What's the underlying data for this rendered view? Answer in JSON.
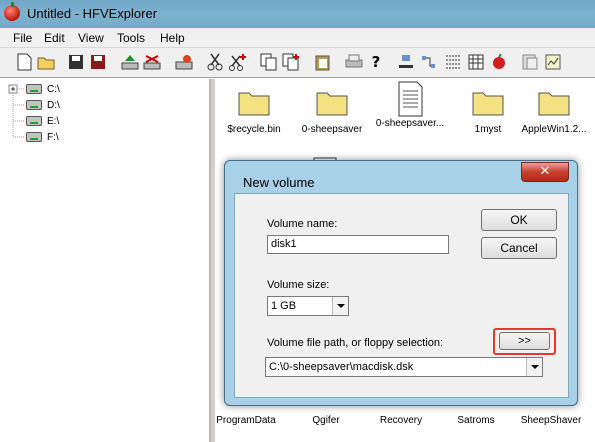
{
  "window": {
    "title": "Untitled - HFVExplorer"
  },
  "menu": [
    "File",
    "Edit",
    "View",
    "Tools",
    "Help"
  ],
  "tree": {
    "nodes": [
      "C:\\",
      "D:\\",
      "E:\\",
      "F:\\"
    ]
  },
  "files": {
    "top_row": [
      "$recycle.bin",
      "0-sheepsaver",
      "0-sheepsaver...",
      "1myst",
      "AppleWin1.2..."
    ],
    "bottom_row": [
      "ProgramData",
      "Qgifer",
      "Recovery",
      "Satroms",
      "SheepShaver"
    ]
  },
  "dialog": {
    "title": "New volume",
    "close_glyph": "✕",
    "volume_name_label": "Volume name:",
    "volume_name_value": "disk1",
    "volume_size_label": "Volume size:",
    "volume_size_value": "1 GB",
    "path_label": "Volume file path, or floppy selection:",
    "path_value": "C:\\0-sheepsaver\\macdisk.dsk",
    "ok_label": "OK",
    "cancel_label": "Cancel",
    "browse_label": ">>"
  },
  "colors": {
    "highlight": "#e03a2a",
    "folder": "#f3e182"
  }
}
